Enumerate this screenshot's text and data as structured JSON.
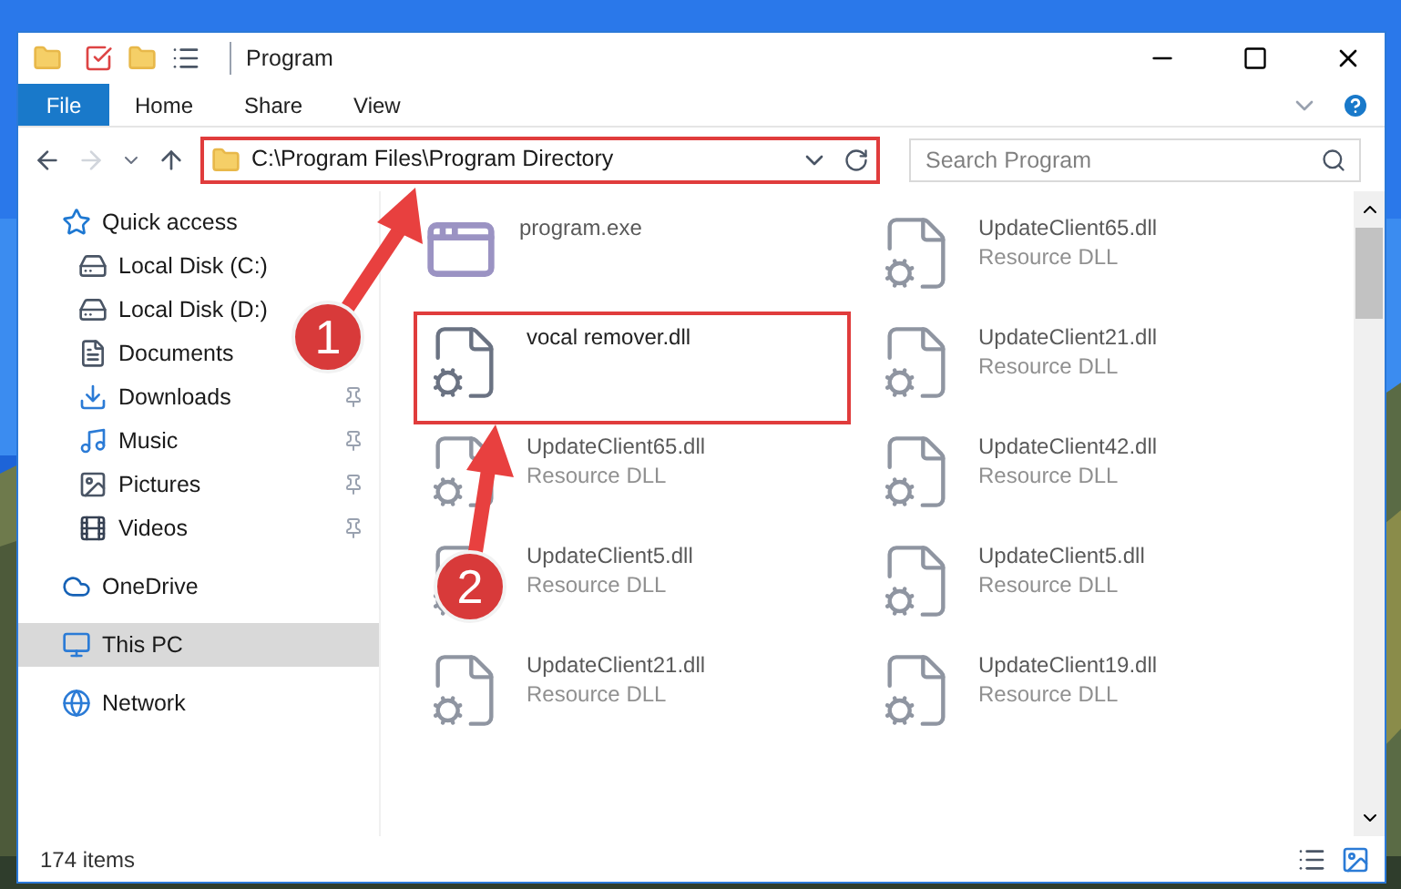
{
  "window": {
    "title": "Program"
  },
  "ribbon_tabs": [
    {
      "label": "File",
      "kind": "file",
      "selected": false
    },
    {
      "label": "Home",
      "kind": "tab",
      "selected": false
    },
    {
      "label": "Share",
      "kind": "tab",
      "selected": false
    },
    {
      "label": "View",
      "kind": "tab",
      "selected": false
    }
  ],
  "address": {
    "path": "C:\\Program Files\\Program Directory",
    "highlighted": true
  },
  "search": {
    "placeholder": "Search Program"
  },
  "sidebar": {
    "items": [
      {
        "label": "Quick access",
        "kind": "quick",
        "selected": false,
        "children": [
          {
            "label": "Local Disk (C:)",
            "kind": "diskc",
            "pinned": false,
            "selected": false
          },
          {
            "label": "Local Disk (D:)",
            "kind": "disk",
            "pinned": false,
            "selected": false
          },
          {
            "label": "Documents",
            "kind": "docs",
            "pinned": false,
            "selected": false
          },
          {
            "label": "Downloads",
            "kind": "downloads",
            "pinned": true,
            "selected": false
          },
          {
            "label": "Music",
            "kind": "music",
            "pinned": true,
            "selected": false
          },
          {
            "label": "Pictures",
            "kind": "pictures",
            "pinned": true,
            "selected": false
          },
          {
            "label": "Videos",
            "kind": "videos",
            "pinned": true,
            "selected": false
          }
        ]
      },
      {
        "label": "OneDrive",
        "kind": "cloud",
        "selected": false
      },
      {
        "label": "This PC",
        "kind": "pc",
        "selected": true
      },
      {
        "label": "Network",
        "kind": "network",
        "selected": false
      }
    ]
  },
  "files": [
    {
      "name": "program.exe",
      "kind": "exe",
      "blurred": true,
      "highlighted": false
    },
    {
      "name": "UpdateClient65.dll",
      "type": "Resource DLL",
      "kind": "dll",
      "blurred": true,
      "highlighted": false
    },
    {
      "name": "vocal remover.dll",
      "kind": "dll",
      "blurred": false,
      "highlighted": true
    },
    {
      "name": "UpdateClient21.dll",
      "type": "Resource DLL",
      "kind": "dll",
      "blurred": true,
      "highlighted": false
    },
    {
      "name": "UpdateClient65.dll",
      "type": "Resource DLL",
      "kind": "dll",
      "blurred": true,
      "highlighted": false
    },
    {
      "name": "UpdateClient42.dll",
      "type": "Resource DLL",
      "kind": "dll",
      "blurred": true,
      "highlighted": false
    },
    {
      "name": "UpdateClient5.dll",
      "type": "Resource DLL",
      "kind": "dll",
      "blurred": true,
      "highlighted": false
    },
    {
      "name": "UpdateClient5.dll",
      "type": "Resource DLL",
      "kind": "dll",
      "blurred": true,
      "highlighted": false
    },
    {
      "name": "UpdateClient21.dll",
      "type": "Resource DLL",
      "kind": "dll",
      "blurred": true,
      "highlighted": false
    },
    {
      "name": "UpdateClient19.dll",
      "type": "Resource DLL",
      "kind": "dll",
      "blurred": true,
      "highlighted": false
    }
  ],
  "status_bar": {
    "count": "174 items"
  },
  "callouts": [
    {
      "number": "1"
    },
    {
      "number": "2"
    }
  ]
}
